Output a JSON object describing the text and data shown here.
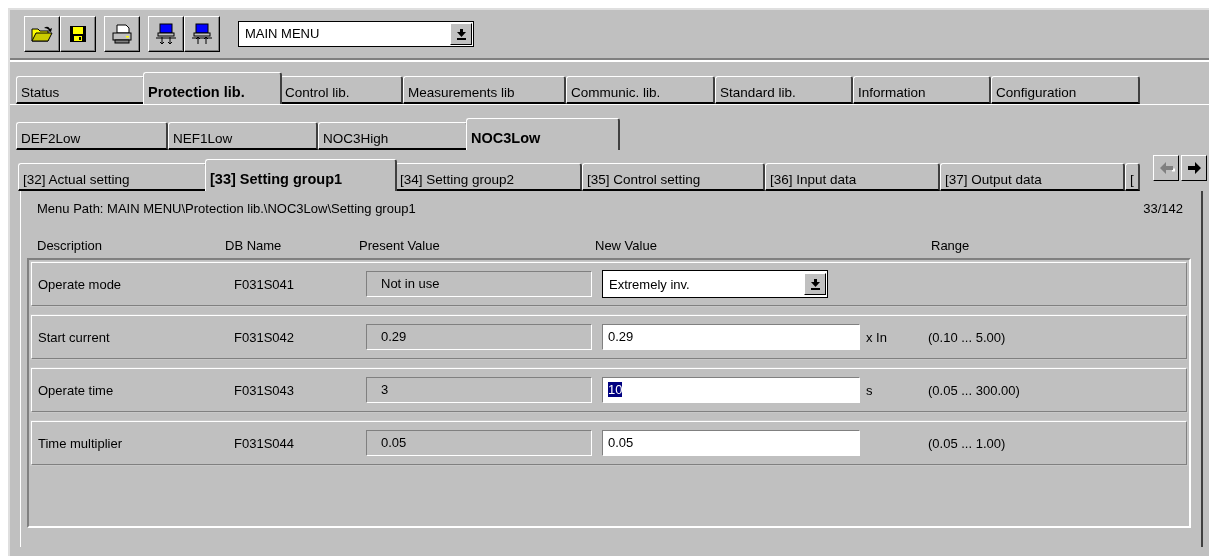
{
  "toolbar": {
    "menu_select": "MAIN MENU"
  },
  "tabs_main": [
    {
      "label": "Status",
      "selected": false
    },
    {
      "label": "Protection lib.",
      "selected": true
    },
    {
      "label": "Control lib.",
      "selected": false
    },
    {
      "label": "Measurements lib",
      "selected": false
    },
    {
      "label": "Communic. lib.",
      "selected": false
    },
    {
      "label": "Standard lib.",
      "selected": false
    },
    {
      "label": "Information",
      "selected": false
    },
    {
      "label": "Configuration",
      "selected": false
    }
  ],
  "tabs_function": [
    {
      "label": "DEF2Low",
      "selected": false
    },
    {
      "label": "NEF1Low",
      "selected": false
    },
    {
      "label": "NOC3High",
      "selected": false
    },
    {
      "label": "NOC3Low",
      "selected": true
    }
  ],
  "tabs_page": [
    {
      "label": "[32] Actual setting",
      "selected": false
    },
    {
      "label": "[33] Setting group1",
      "selected": true
    },
    {
      "label": "[34] Setting group2",
      "selected": false
    },
    {
      "label": "[35] Control setting",
      "selected": false
    },
    {
      "label": "[36] Input data",
      "selected": false
    },
    {
      "label": "[37] Output data",
      "selected": false
    },
    {
      "label": "[",
      "selected": false
    }
  ],
  "page_scroll": {
    "left_disabled": true,
    "right_disabled": false
  },
  "menu_path": "Menu Path:  MAIN MENU\\Protection lib.\\NOC3Low\\Setting group1",
  "page_counter": "33/142",
  "columns": [
    "Description",
    "DB Name",
    "Present Value",
    "New Value",
    "Range"
  ],
  "rows": [
    {
      "kind": "dropdown",
      "description": "Operate mode",
      "db_name": "F031S041",
      "present_value": "Not in use",
      "new_value": "Extremely inv."
    },
    {
      "kind": "input",
      "description": "Start current",
      "db_name": "F031S042",
      "present_value": "0.29",
      "new_value": "0.29",
      "highlighted": false,
      "unit": "x In",
      "range": "(0.10 ... 5.00)"
    },
    {
      "kind": "input",
      "description": "Operate time",
      "db_name": "F031S043",
      "present_value": "3",
      "new_value": "10",
      "highlighted": true,
      "unit": "s",
      "range": "(0.05 ... 300.00)"
    },
    {
      "kind": "input",
      "description": "Time multiplier",
      "db_name": "F031S044",
      "present_value": "0.05",
      "new_value": "0.05",
      "highlighted": false,
      "range": "(0.05 ... 1.00)"
    }
  ]
}
